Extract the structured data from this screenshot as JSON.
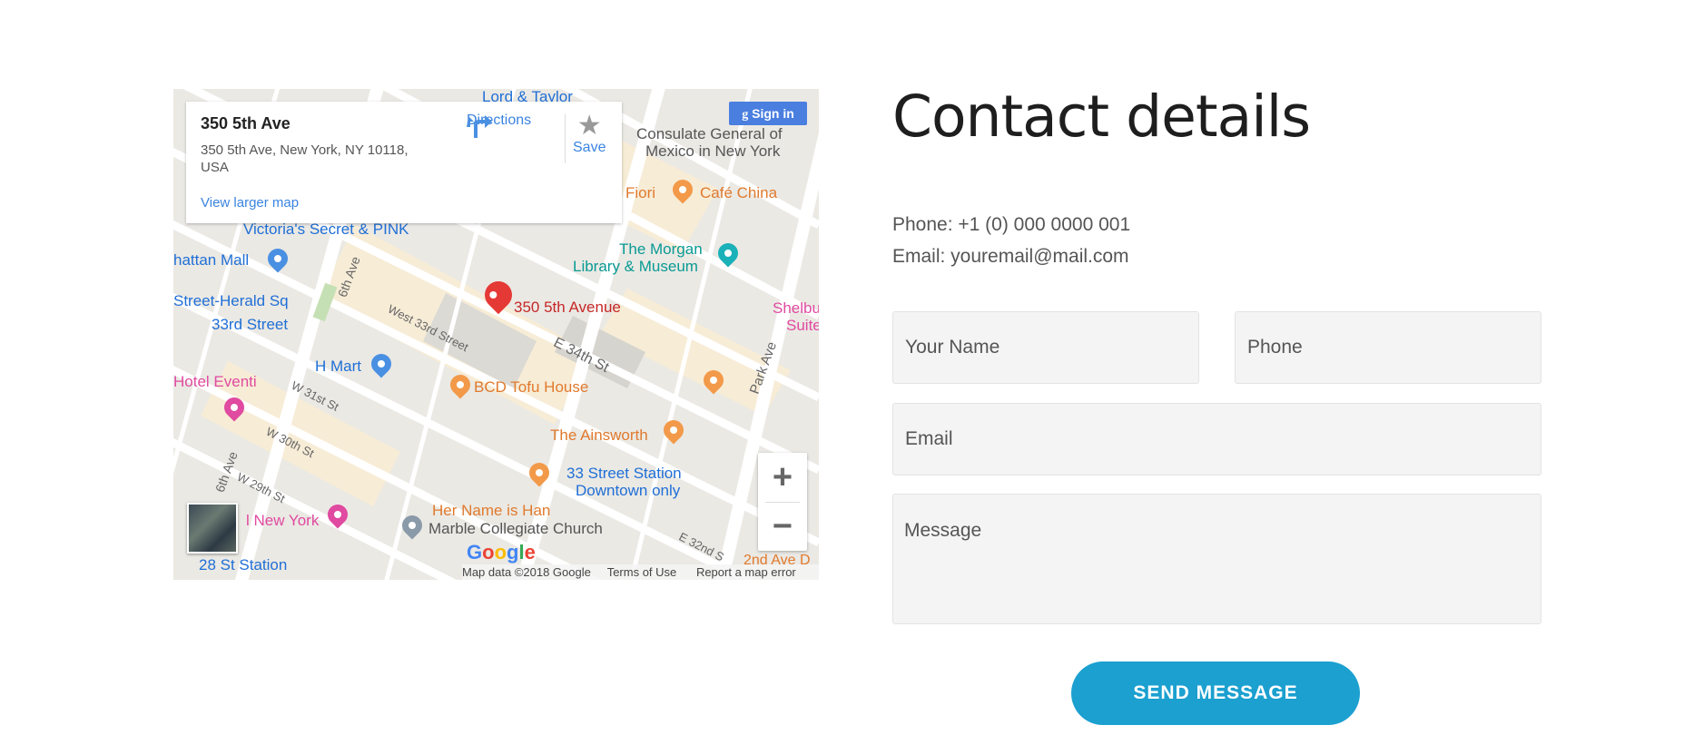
{
  "map": {
    "info_card": {
      "title": "350 5th Ave",
      "address": "350 5th Ave, New York, NY 10118, USA",
      "directions_label": "Directions",
      "save_label": "Save",
      "view_larger_label": "View larger map"
    },
    "sign_in_label": "Sign in",
    "places": {
      "lord_taylor": "Lord & Taylor",
      "consulate": "Consulate General of",
      "consulate2": "Mexico in New York",
      "fiori": "Fiori",
      "cafe_china": "Café China",
      "victorias_secret": "Victoria's Secret & PINK",
      "manhattan_mall": "hattan Mall",
      "morgan": "The Morgan",
      "morgan2": "Library & Museum",
      "shelburne": "Shelbu",
      "shelburne2": "Suite",
      "herald_sq": "Street-Herald Sq",
      "st33": "33rd Street",
      "marker_label": "350 5th Avenue",
      "sixth_ave": "6th Ave",
      "w33": "West 33rd Street",
      "e34": "E 34th St",
      "hmart": "H Mart",
      "bcd": "BCD Tofu House",
      "hotel_eventi": "Hotel Eventi",
      "w31": "W 31st St",
      "park_ave": "Park Ave",
      "ainsworth": "The Ainsworth",
      "w30": "W 30th St",
      "station33": "33 Street Station",
      "station33b": "Downtown only",
      "sixth_ave2": "6th Ave",
      "w29": "W 29th St",
      "her_name": "Her Name is Han",
      "marble": "Marble Collegiate Church",
      "new_york": "l New York",
      "e32": "E 32nd S",
      "nd_ave": "2nd Ave D",
      "st28": "28 St Station"
    },
    "google_logo": "Google",
    "attribution": {
      "map_data": "Map data ©2018 Google",
      "terms": "Terms of Use",
      "report": "Report a map error"
    },
    "zoom_in": "+",
    "zoom_out": "−"
  },
  "contact": {
    "heading": "Contact details",
    "phone": "Phone: +1 (0) 000 0000 001",
    "email": "Email: youremail@mail.com"
  },
  "form": {
    "name_placeholder": "Your Name",
    "phone_placeholder": "Phone",
    "email_placeholder": "Email",
    "message_placeholder": "Message",
    "submit_label": "SEND MESSAGE"
  },
  "colors": {
    "accent": "#1ba0d0",
    "marker": "#e53935",
    "link": "#3a84df"
  },
  "icons": [
    "directions-icon",
    "star-icon",
    "map-pin-icon",
    "google-g-icon"
  ]
}
